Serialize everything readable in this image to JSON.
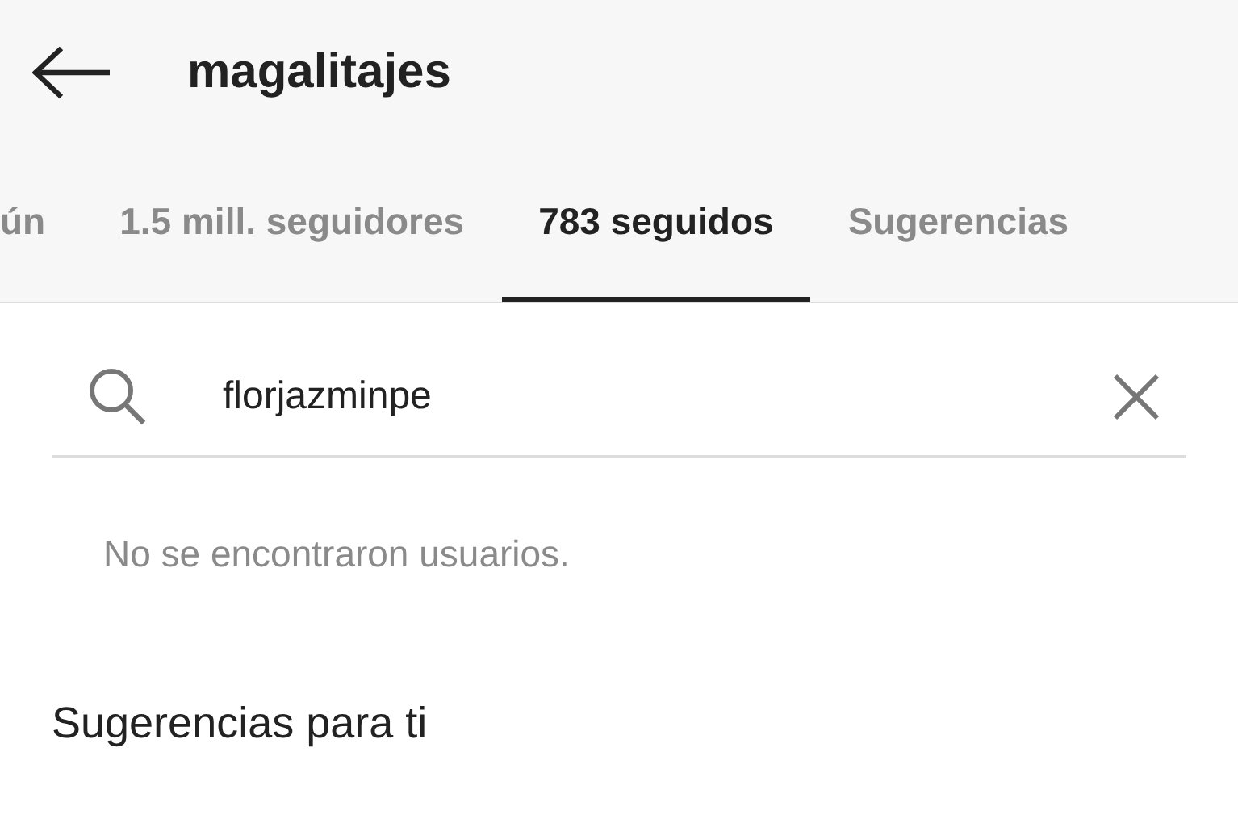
{
  "header": {
    "title": "magalitajes"
  },
  "tabs": [
    {
      "label": "ún",
      "selected": false
    },
    {
      "label": "1.5 mill. seguidores",
      "selected": false
    },
    {
      "label": "783 seguidos",
      "selected": true
    },
    {
      "label": "Sugerencias",
      "selected": false
    }
  ],
  "search": {
    "value": "florjazminpe"
  },
  "empty_message": "No se encontraron usuarios.",
  "section_title": "Sugerencias para ti"
}
